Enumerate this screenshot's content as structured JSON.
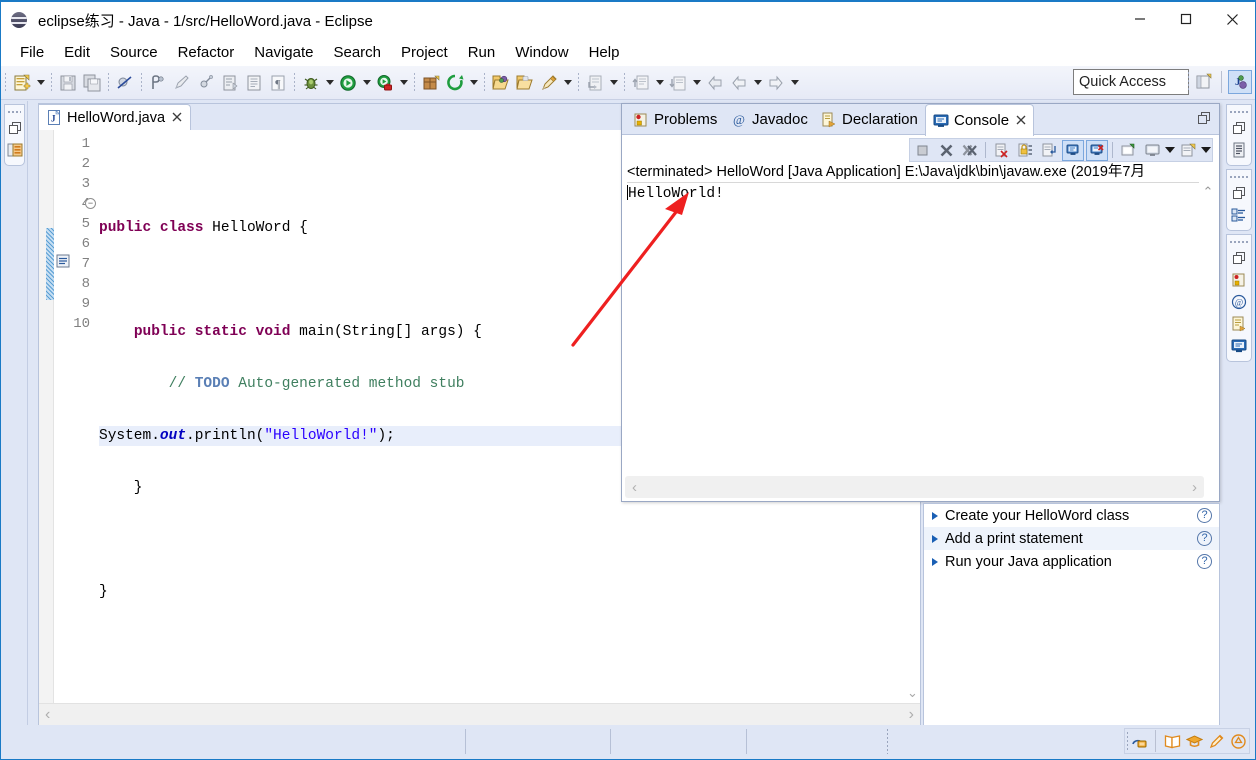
{
  "window": {
    "title": "eclipse练习 - Java - 1/src/HelloWord.java - Eclipse",
    "app_icon": "eclipse-globe-icon",
    "minimize_label": "Minimize",
    "maximize_label": "Maximize",
    "close_label": "Close"
  },
  "menubar": {
    "items": [
      {
        "label": "File"
      },
      {
        "label": "Edit"
      },
      {
        "label": "Source"
      },
      {
        "label": "Refactor"
      },
      {
        "label": "Navigate"
      },
      {
        "label": "Search"
      },
      {
        "label": "Project"
      },
      {
        "label": "Run"
      },
      {
        "label": "Window"
      },
      {
        "label": "Help"
      }
    ]
  },
  "toolbar": {
    "quick_access_placeholder": "Quick Access",
    "quick_access_value": "",
    "buttons": [
      {
        "name": "new-wizard-icon",
        "tooltip": "New"
      },
      {
        "name": "save-icon",
        "tooltip": "Save"
      },
      {
        "name": "save-all-icon",
        "tooltip": "Save All"
      },
      {
        "name": "skip-breakpoints-icon",
        "tooltip": "Skip All Breakpoints"
      },
      {
        "name": "toggle-mark-occurrences-icon",
        "tooltip": "Toggle Mark Occurrences"
      },
      {
        "name": "new-java-package-icon",
        "tooltip": "New Java Package"
      },
      {
        "name": "new-java-class-icon",
        "tooltip": "New Java Class"
      },
      {
        "name": "open-task-icon",
        "tooltip": "Open Task"
      },
      {
        "name": "show-whitespace-icon",
        "tooltip": "Show Whitespace Characters"
      },
      {
        "name": "debug-icon",
        "tooltip": "Debug"
      },
      {
        "name": "run-icon",
        "tooltip": "Run"
      },
      {
        "name": "coverage-icon",
        "tooltip": "Coverage"
      },
      {
        "name": "new-package-icon",
        "tooltip": "New Package"
      },
      {
        "name": "external-tools-icon",
        "tooltip": "External Tools"
      },
      {
        "name": "open-type-icon",
        "tooltip": "Open Type"
      },
      {
        "name": "open-resource-icon",
        "tooltip": "Open Resource"
      },
      {
        "name": "search-icon",
        "tooltip": "Search"
      },
      {
        "name": "previous-annotation-icon",
        "tooltip": "Previous Annotation"
      },
      {
        "name": "next-annotation-icon",
        "tooltip": "Next Annotation"
      },
      {
        "name": "last-edit-location-icon",
        "tooltip": "Last Edit Location"
      },
      {
        "name": "back-icon",
        "tooltip": "Back"
      },
      {
        "name": "forward-icon",
        "tooltip": "Forward"
      }
    ],
    "right_buttons": [
      {
        "name": "open-perspective-icon",
        "tooltip": "Open Perspective"
      },
      {
        "name": "java-perspective-icon",
        "tooltip": "Java"
      }
    ]
  },
  "leftbar": {
    "items": [
      {
        "name": "restore-icon",
        "label": "Restore"
      },
      {
        "name": "package-explorer-icon",
        "label": "Package Explorer"
      }
    ]
  },
  "rightbar": {
    "stacks": [
      {
        "items": [
          {
            "name": "restore-icon"
          },
          {
            "name": "outline-icon"
          }
        ]
      },
      {
        "items": [
          {
            "name": "restore-icon"
          },
          {
            "name": "task-list-icon"
          }
        ]
      },
      {
        "items": [
          {
            "name": "restore-icon"
          },
          {
            "name": "problems-icon"
          },
          {
            "name": "javadoc-icon"
          },
          {
            "name": "declaration-icon"
          },
          {
            "name": "console-icon"
          }
        ]
      }
    ]
  },
  "editor": {
    "tab": {
      "label": "HelloWord.java",
      "icon": "java-file-icon",
      "close": "✕",
      "dirty": false
    },
    "line_numbers": [
      "1",
      "2",
      "3",
      "4",
      "5",
      "6",
      "7",
      "8",
      "9",
      "10"
    ],
    "lines": [
      {
        "n": "1",
        "text": "",
        "highlight": false
      },
      {
        "n": "2",
        "text": "public class HelloWord {",
        "highlight": false
      },
      {
        "n": "3",
        "text": "",
        "highlight": false
      },
      {
        "n": "4",
        "text": "    public static void main(String[] args) {",
        "highlight": false,
        "fold": true
      },
      {
        "n": "5",
        "text": "        // TODO Auto-generated method stub",
        "highlight": false
      },
      {
        "n": "6",
        "text": "System.out.println(\"HelloWorld!\");",
        "highlight": true
      },
      {
        "n": "7",
        "text": "    }",
        "highlight": false
      },
      {
        "n": "8",
        "text": "",
        "highlight": false
      },
      {
        "n": "9",
        "text": "}",
        "highlight": false
      },
      {
        "n": "10",
        "text": "",
        "highlight": false
      }
    ],
    "tokens": {
      "l2_kw_public": "public",
      "l2_kw_class": "class",
      "l2_name": " HelloWord {",
      "l4_kw": "public static void",
      "l4_rest": " main(String[] args) {",
      "l5_comment": "// ",
      "l5_todo": "TODO",
      "l5_comment_rest": " Auto-generated method stub",
      "l6_a": "System.",
      "l6_field": "out",
      "l6_b": ".println(",
      "l6_str": "\"HelloWorld!\"",
      "l6_c": ");",
      "l7": "    }",
      "l9": "}"
    },
    "scroll": {
      "left_arrow": "‹",
      "right_arrow": "›",
      "down_arrow": "⌄"
    }
  },
  "console_panel": {
    "tabs": [
      {
        "label": "Problems",
        "icon": "problems-icon",
        "active": false
      },
      {
        "label": "Javadoc",
        "icon": "javadoc-icon",
        "active": false
      },
      {
        "label": "Declaration",
        "icon": "declaration-icon",
        "active": false
      },
      {
        "label": "Console",
        "icon": "console-icon",
        "active": true,
        "close": "✕"
      }
    ],
    "minmax_label": "Restore",
    "toolbar": [
      {
        "name": "terminate-icon",
        "tooltip": "Terminate",
        "toggled": false
      },
      {
        "name": "remove-launch-icon",
        "tooltip": "Remove Launch",
        "toggled": false
      },
      {
        "name": "remove-all-terminated-icon",
        "tooltip": "Remove All Terminated Launches",
        "toggled": false
      },
      {
        "name": "clear-console-icon",
        "tooltip": "Clear Console",
        "toggled": false
      },
      {
        "name": "scroll-lock-icon",
        "tooltip": "Scroll Lock",
        "toggled": false
      },
      {
        "name": "word-wrap-icon",
        "tooltip": "Word Wrap",
        "toggled": false
      },
      {
        "name": "show-console-on-output-icon",
        "tooltip": "Show Console When Standard Out Changes",
        "toggled": true
      },
      {
        "name": "show-console-on-error-icon",
        "tooltip": "Show Console When Standard Error Changes",
        "toggled": true
      },
      {
        "name": "pin-console-icon",
        "tooltip": "Pin Console",
        "toggled": false
      },
      {
        "name": "display-selected-console-icon",
        "tooltip": "Display Selected Console",
        "toggled": false
      },
      {
        "name": "open-console-icon",
        "tooltip": "Open Console",
        "toggled": false
      }
    ],
    "header": "<terminated> HelloWord [Java Application] E:\\Java\\jdk\\bin\\javaw.exe (2019年7月",
    "output": "HelloWorld!",
    "scroll": {
      "up_arrow": "⌃",
      "left_arrow": "‹",
      "right_arrow": "›"
    }
  },
  "cheatsheet": {
    "rows": [
      {
        "label": "Create your HelloWord class",
        "help": "?",
        "selected": false
      },
      {
        "label": "Add a print statement",
        "help": "?",
        "selected": true
      },
      {
        "label": "Run your Java application",
        "help": "?",
        "selected": false
      }
    ]
  },
  "statusbar": {
    "message": "",
    "right_icons": [
      {
        "name": "writable-lock-icon"
      },
      {
        "name": "book-icon"
      },
      {
        "name": "graduation-cap-icon"
      },
      {
        "name": "pencil-icon"
      },
      {
        "name": "badge-icon"
      }
    ]
  },
  "annotation": {
    "arrow": "red-arrow-pointing-to-console-output",
    "color": "#ee2020"
  },
  "colors": {
    "chrome": "#dfe6f5",
    "accent": "#1a7ac6",
    "keyword": "#7f0055",
    "string": "#2a00ff",
    "comment": "#3f7f5f",
    "field": "#0000c0",
    "selection": "#e8eefb",
    "annotation_red": "#ee2020"
  }
}
